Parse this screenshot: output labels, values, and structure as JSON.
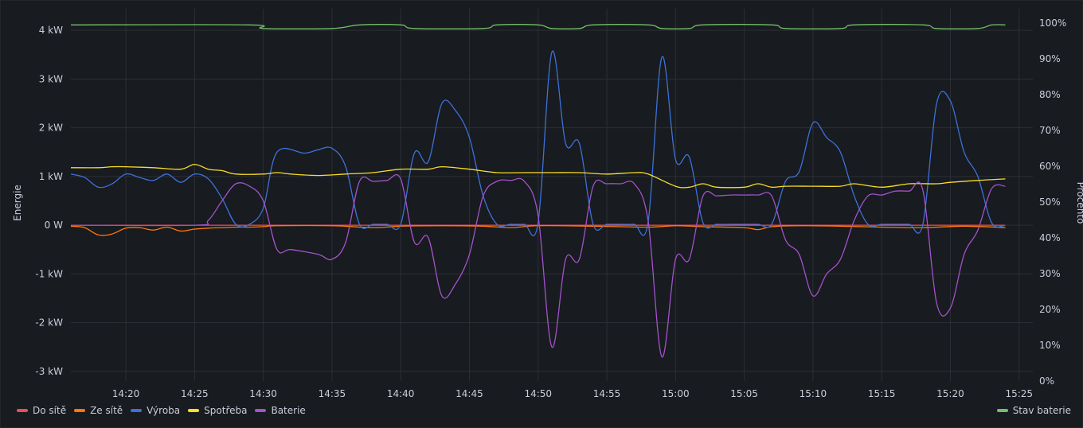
{
  "chart_data": {
    "type": "line",
    "xlabel": "",
    "ylabel_left": "Energie",
    "ylabel_right": "Procento",
    "x_ticks": [
      "14:20",
      "14:25",
      "14:30",
      "14:35",
      "14:40",
      "14:45",
      "14:50",
      "14:55",
      "15:00",
      "15:05",
      "15:10",
      "15:15",
      "15:20",
      "15:25"
    ],
    "y_left_ticks": [
      "4 kW",
      "3 kW",
      "2 kW",
      "1 kW",
      "0 W",
      "-1 kW",
      "-2 kW",
      "-3 kW"
    ],
    "y_right_ticks": [
      "100%",
      "90%",
      "80%",
      "70%",
      "60%",
      "50%",
      "40%",
      "30%",
      "20%",
      "10%",
      "0%"
    ],
    "ylim_left": [
      -3.2,
      4.15
    ],
    "ylim_right": [
      0,
      100
    ],
    "xlim": [
      "14:16",
      "15:26"
    ],
    "grid": true,
    "legend_placement": "bottom",
    "series": [
      {
        "name": "Do sítě",
        "axis": "left",
        "color": "#f2495c",
        "unit": "kW",
        "x": [
          "14:16",
          "15:24"
        ],
        "values": [
          0.0,
          0.0
        ]
      },
      {
        "name": "Ze sítě",
        "axis": "left",
        "color": "#ff780a",
        "unit": "kW",
        "x": [
          "14:16",
          "14:17",
          "14:18",
          "14:19",
          "14:20",
          "14:21",
          "14:22",
          "14:23",
          "14:24",
          "14:25",
          "14:26",
          "14:27",
          "14:28",
          "14:29",
          "14:30",
          "14:31",
          "14:35",
          "14:38",
          "14:40",
          "14:43",
          "14:46",
          "14:48",
          "14:50",
          "14:54",
          "14:58",
          "15:00",
          "15:02",
          "15:05",
          "15:06",
          "15:07",
          "15:09",
          "15:12",
          "15:15",
          "15:18",
          "15:21",
          "15:24"
        ],
        "values": [
          -0.02,
          -0.05,
          -0.2,
          -0.18,
          -0.06,
          -0.05,
          -0.1,
          -0.04,
          -0.12,
          -0.08,
          -0.06,
          -0.05,
          -0.04,
          -0.04,
          -0.03,
          -0.01,
          -0.01,
          -0.05,
          -0.02,
          -0.01,
          -0.02,
          -0.05,
          -0.01,
          -0.02,
          -0.04,
          -0.01,
          -0.03,
          -0.05,
          -0.09,
          -0.03,
          -0.01,
          -0.02,
          -0.04,
          -0.05,
          -0.02,
          -0.05
        ]
      },
      {
        "name": "Výroba",
        "axis": "left",
        "color": "#3d71d9",
        "unit": "kW",
        "x": [
          "14:16",
          "14:17",
          "14:18",
          "14:19",
          "14:20",
          "14:21",
          "14:22",
          "14:23",
          "14:24",
          "14:25",
          "14:26",
          "14:27",
          "14:28",
          "14:29",
          "14:30",
          "14:31",
          "14:33",
          "14:34",
          "14:35",
          "14:36",
          "14:37",
          "14:38",
          "14:39",
          "14:40",
          "14:41",
          "14:42",
          "14:43",
          "14:44",
          "14:45",
          "14:46",
          "14:47",
          "14:48",
          "14:49",
          "14:50",
          "14:51",
          "14:52",
          "14:53",
          "14:54",
          "14:55",
          "14:56",
          "14:57",
          "14:58",
          "14:59",
          "15:00",
          "15:01",
          "15:02",
          "15:03",
          "15:04",
          "15:05",
          "15:06",
          "15:07",
          "15:08",
          "15:09",
          "15:10",
          "15:11",
          "15:12",
          "15:13",
          "15:14",
          "15:15",
          "15:16",
          "15:17",
          "15:18",
          "15:19",
          "15:20",
          "15:21",
          "15:22",
          "15:23",
          "15:24"
        ],
        "values": [
          1.05,
          0.98,
          0.78,
          0.85,
          1.05,
          0.98,
          0.92,
          1.05,
          0.88,
          1.05,
          0.95,
          0.55,
          0.02,
          0.02,
          0.35,
          1.5,
          1.48,
          1.55,
          1.58,
          1.2,
          0.02,
          0.02,
          0.02,
          0.02,
          1.48,
          1.3,
          2.5,
          2.35,
          1.8,
          0.6,
          0.02,
          0.02,
          0.02,
          0.05,
          3.55,
          1.68,
          1.68,
          0.02,
          0.02,
          0.02,
          0.02,
          0.05,
          3.45,
          1.35,
          1.4,
          0.05,
          0.02,
          0.02,
          0.02,
          0.02,
          0.02,
          0.9,
          1.1,
          2.1,
          1.8,
          1.5,
          0.6,
          0.02,
          0.02,
          0.02,
          0.02,
          0.02,
          2.5,
          2.55,
          1.5,
          1.0,
          0.05,
          0.0
        ]
      },
      {
        "name": "Spotřeba",
        "axis": "left",
        "color": "#fade2a",
        "unit": "kW",
        "x": [
          "14:16",
          "14:18",
          "14:19",
          "14:20",
          "14:22",
          "14:24",
          "14:25",
          "14:26",
          "14:27",
          "14:28",
          "14:30",
          "14:31",
          "14:32",
          "14:34",
          "14:36",
          "14:38",
          "14:40",
          "14:42",
          "14:43",
          "14:45",
          "14:47",
          "14:49",
          "14:51",
          "14:53",
          "14:55",
          "14:57",
          "14:58",
          "15:00",
          "15:01",
          "15:02",
          "15:03",
          "15:05",
          "15:06",
          "15:07",
          "15:08",
          "15:10",
          "15:12",
          "15:13",
          "15:15",
          "15:17",
          "15:19",
          "15:20",
          "15:22",
          "15:24"
        ],
        "values": [
          1.18,
          1.18,
          1.2,
          1.2,
          1.18,
          1.15,
          1.25,
          1.15,
          1.12,
          1.05,
          1.05,
          1.08,
          1.05,
          1.02,
          1.05,
          1.08,
          1.15,
          1.15,
          1.2,
          1.15,
          1.08,
          1.08,
          1.08,
          1.08,
          1.05,
          1.08,
          1.05,
          0.8,
          0.78,
          0.85,
          0.78,
          0.78,
          0.85,
          0.78,
          0.8,
          0.8,
          0.8,
          0.85,
          0.78,
          0.85,
          0.85,
          0.88,
          0.92,
          0.95
        ]
      },
      {
        "name": "Baterie",
        "axis": "left",
        "color": "#a352cc",
        "unit": "kW",
        "x": [
          "14:16",
          "14:25",
          "14:26",
          "14:27",
          "14:28",
          "14:29",
          "14:30",
          "14:31",
          "14:32",
          "14:34",
          "14:35",
          "14:36",
          "14:37",
          "14:38",
          "14:39",
          "14:40",
          "14:41",
          "14:42",
          "14:43",
          "14:44",
          "14:45",
          "14:46",
          "14:47",
          "14:48",
          "14:49",
          "14:50",
          "14:51",
          "14:52",
          "14:53",
          "14:54",
          "14:55",
          "14:56",
          "14:57",
          "14:58",
          "14:59",
          "15:00",
          "15:01",
          "15:02",
          "15:03",
          "15:04",
          "15:05",
          "15:06",
          "15:07",
          "15:08",
          "15:09",
          "15:10",
          "15:11",
          "15:12",
          "15:13",
          "15:14",
          "15:15",
          "15:16",
          "15:17",
          "15:18",
          "15:19",
          "15:20",
          "15:21",
          "15:22",
          "15:23",
          "15:24"
        ],
        "values": [
          0.0,
          0.0,
          0.1,
          0.5,
          0.85,
          0.8,
          0.5,
          -0.5,
          -0.5,
          -0.6,
          -0.7,
          -0.35,
          0.9,
          0.9,
          0.92,
          0.95,
          -0.35,
          -0.25,
          -1.45,
          -1.2,
          -0.6,
          0.6,
          0.9,
          0.92,
          0.9,
          0.2,
          -2.5,
          -0.7,
          -0.7,
          0.8,
          0.85,
          0.85,
          0.85,
          0.1,
          -2.7,
          -0.7,
          -0.7,
          0.6,
          0.6,
          0.62,
          0.62,
          0.62,
          0.6,
          -0.3,
          -0.6,
          -1.45,
          -1.0,
          -0.7,
          0.1,
          0.6,
          0.62,
          0.7,
          0.7,
          0.72,
          -1.6,
          -1.7,
          -0.6,
          -0.1,
          0.75,
          0.8
        ]
      },
      {
        "name": "Stav baterie",
        "axis": "right",
        "color": "#73bf69",
        "unit": "%",
        "x": [
          "14:16",
          "14:29",
          "14:30",
          "14:35",
          "14:37",
          "14:40",
          "14:41",
          "14:46",
          "14:47",
          "14:50",
          "14:51",
          "14:53",
          "14:54",
          "14:58",
          "14:59",
          "15:01",
          "15:02",
          "15:07",
          "15:08",
          "15:12",
          "15:13",
          "15:18",
          "15:19",
          "15:22",
          "15:23",
          "15:24"
        ],
        "values": [
          99.5,
          99.5,
          98.5,
          98.5,
          99.5,
          99.5,
          98.5,
          98.5,
          99.5,
          99.5,
          98.5,
          98.5,
          99.5,
          99.5,
          98.5,
          98.5,
          99.5,
          99.5,
          98.5,
          98.5,
          99.5,
          99.5,
          98.5,
          98.5,
          99.5,
          99.5
        ]
      }
    ]
  }
}
